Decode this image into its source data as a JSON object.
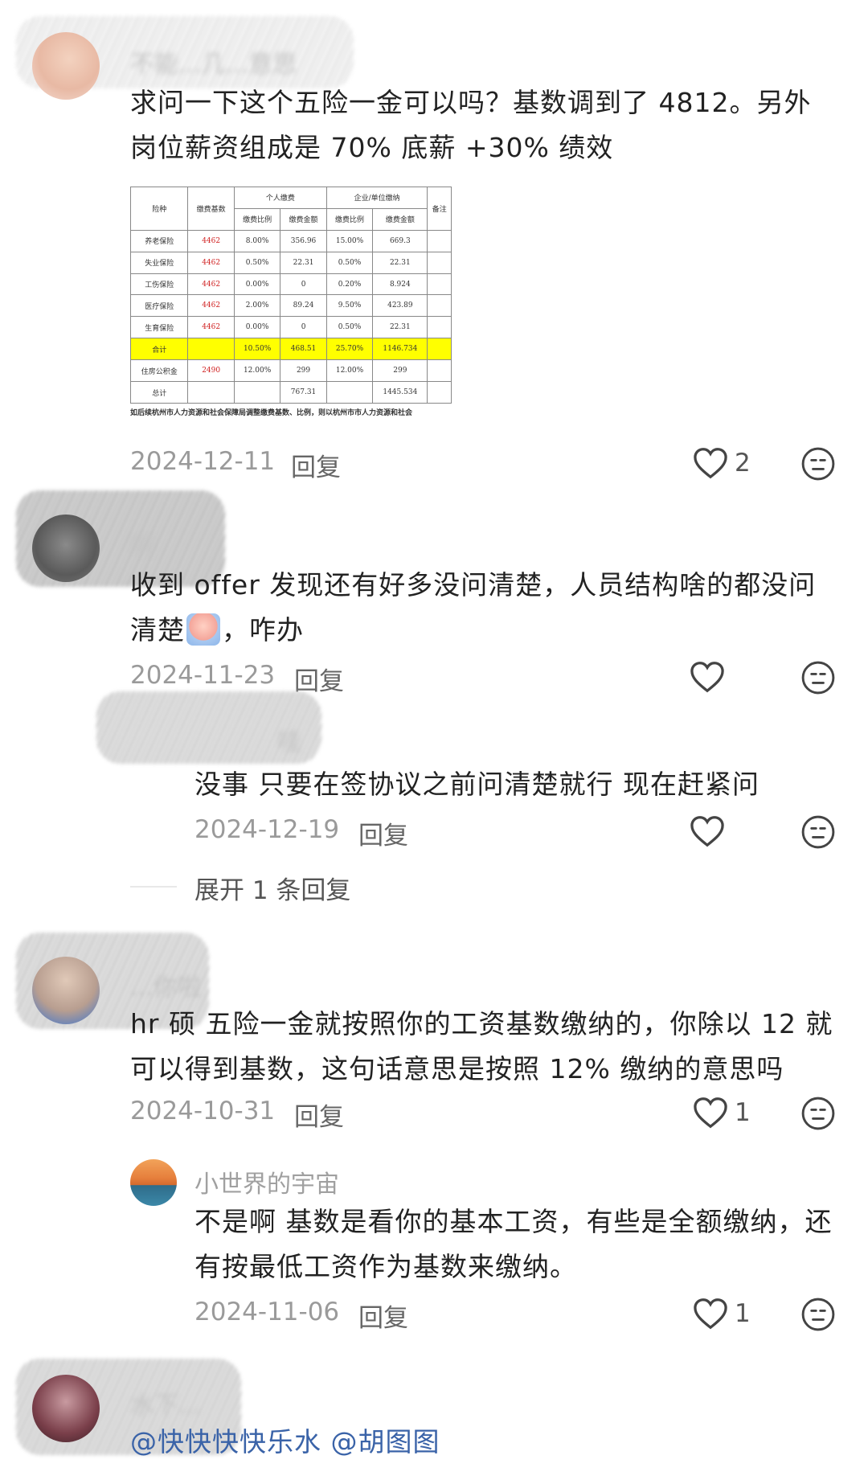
{
  "comments": [
    {
      "username": "不能...几...意思",
      "text": "求问一下这个五险一金可以吗？基数调到了 4812。另外岗位薪资组成是 70% 底薪 +30% 绩效",
      "date": "2024-12-11",
      "reply_label": "回复",
      "likes": "2",
      "table": {
        "header_personal": "个人缴费",
        "header_company": "企业/单位缴纳",
        "col_type": "险种",
        "col_base": "缴费基数",
        "col_ratio": "缴费比例",
        "col_amount": "缴费金额",
        "col_note": "备注",
        "rows": [
          {
            "type": "养老保险",
            "base": "4462",
            "p_ratio": "8.00%",
            "p_amt": "356.96",
            "c_ratio": "15.00%",
            "c_amt": "669.3"
          },
          {
            "type": "失业保险",
            "base": "4462",
            "p_ratio": "0.50%",
            "p_amt": "22.31",
            "c_ratio": "0.50%",
            "c_amt": "22.31"
          },
          {
            "type": "工伤保险",
            "base": "4462",
            "p_ratio": "0.00%",
            "p_amt": "0",
            "c_ratio": "0.20%",
            "c_amt": "8.924"
          },
          {
            "type": "医疗保险",
            "base": "4462",
            "p_ratio": "2.00%",
            "p_amt": "89.24",
            "c_ratio": "9.50%",
            "c_amt": "423.89"
          },
          {
            "type": "生育保险",
            "base": "4462",
            "p_ratio": "0.00%",
            "p_amt": "0",
            "c_ratio": "0.50%",
            "c_amt": "22.31"
          },
          {
            "type": "合计",
            "base": "",
            "p_ratio": "10.50%",
            "p_amt": "468.51",
            "c_ratio": "25.70%",
            "c_amt": "1146.734"
          },
          {
            "type": "住房公积金",
            "base": "2490",
            "p_ratio": "12.00%",
            "p_amt": "299",
            "c_ratio": "12.00%",
            "c_amt": "299"
          },
          {
            "type": "总计",
            "base": "",
            "p_ratio": "",
            "p_amt": "767.31",
            "c_ratio": "",
            "c_amt": "1445.534"
          }
        ],
        "footnote": "如后续杭州市人力资源和社会保障局调整缴费基数、比例，则以杭州市市人力资源和社会"
      }
    },
    {
      "username": "啊",
      "text_part1": "收到 offer 发现还有好多没问清楚，人员结构啥的都没问清楚",
      "text_part2": "，咋办",
      "date": "2024-11-23",
      "reply_label": "回复",
      "replies": [
        {
          "username": "哇",
          "text": "没事 只要在签协议之前问清楚就行 现在赶紧问",
          "date": "2024-12-19",
          "reply_label": "回复"
        }
      ],
      "expand_label": "展开 1 条回复"
    },
    {
      "username": "...你啦",
      "text": "hr 硕 五险一金就按照你的工资基数缴纳的，你除以 12 就可以得到基数，这句话意思是按照 12% 缴纳的意思吗",
      "date": "2024-10-31",
      "reply_label": "回复",
      "likes": "1",
      "replies": [
        {
          "username": "小世界的宇宙",
          "text": "不是啊 基数是看你的基本工资，有些是全额缴纳，还有按最低工资作为基数来缴纳。",
          "date": "2024-11-06",
          "reply_label": "回复",
          "likes": "1"
        }
      ]
    },
    {
      "username": "水下...",
      "mention1": "@快快快快乐水",
      "mention2": "@胡图图"
    }
  ]
}
